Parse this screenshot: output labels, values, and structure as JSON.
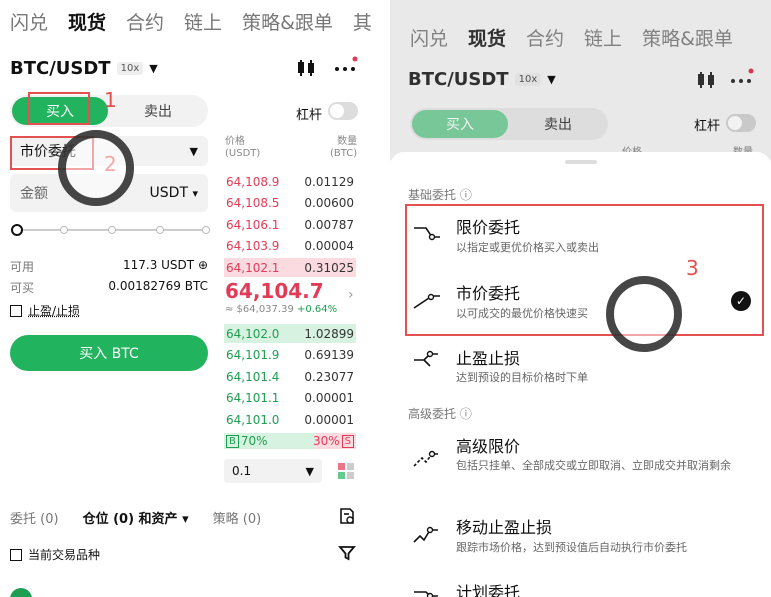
{
  "left": {
    "nav": [
      "闪兑",
      "现货",
      "合约",
      "链上",
      "策略&跟单",
      "其"
    ],
    "pair": "BTC/USDT",
    "leverage": "10x",
    "buy_tab": "买入",
    "sell_tab": "卖出",
    "margin_label": "杠杆",
    "order_type": "市价委托",
    "amount_label": "金额",
    "amount_unit": "USDT",
    "available_label": "可用",
    "available_value": "117.3 USDT",
    "can_buy_label": "可买",
    "can_buy_value": "0.00182769 BTC",
    "tpsl_label": "止盈/止损",
    "buy_button": "买入 BTC",
    "ob_price_header": "价格\n(USDT)",
    "ob_qty_header": "数量\n(BTC)",
    "asks": [
      {
        "price": "64,108.9",
        "size": "0.01129"
      },
      {
        "price": "64,108.5",
        "size": "0.00600"
      },
      {
        "price": "64,106.1",
        "size": "0.00787"
      },
      {
        "price": "64,103.9",
        "size": "0.00004"
      },
      {
        "price": "64,102.1",
        "size": "0.31025"
      }
    ],
    "last_price": "64,104.7",
    "last_usd": "≈ $64,037.39",
    "last_change": "+0.64%",
    "bids": [
      {
        "price": "64,102.0",
        "size": "1.02899"
      },
      {
        "price": "64,101.9",
        "size": "0.69139"
      },
      {
        "price": "64,101.4",
        "size": "0.23077"
      },
      {
        "price": "64,101.1",
        "size": "0.00001"
      },
      {
        "price": "64,101.0",
        "size": "0.00001"
      }
    ],
    "buy_ratio_tag": "B",
    "buy_ratio": "70%",
    "sell_ratio": "30%",
    "sell_ratio_tag": "S",
    "buy_ratio_value": 0.7,
    "precision": "0.1",
    "bottom_tabs": [
      "委托 (0)",
      "仓位 (0) 和资产 ▾",
      "策略 (0)"
    ],
    "current_pair_only": "当前交易品种",
    "annotation_1": "1",
    "annotation_2": "2"
  },
  "right": {
    "nav": [
      "闪兑",
      "现货",
      "合约",
      "链上",
      "策略&跟单"
    ],
    "pair": "BTC/USDT",
    "leverage": "10x",
    "buy_tab": "买入",
    "sell_tab": "卖出",
    "margin_label": "杠杆",
    "ob_price_header": "价格",
    "ob_qty_header": "数量",
    "section_basic": "基础委托 ⓘ",
    "section_advanced": "高级委托 ⓘ",
    "items": [
      {
        "title": "限价委托",
        "desc": "以指定或更优价格买入或卖出"
      },
      {
        "title": "市价委托",
        "desc": "以可成交的最优价格快速买"
      },
      {
        "title": "止盈止损",
        "desc": "达到预设的目标价格时下单"
      },
      {
        "title": "高级限价",
        "desc": "包括只挂单、全部成交或立即取消、立即成交并取消剩余"
      },
      {
        "title": "移动止盈止损",
        "desc": "跟踪市场价格，达到预设值后自动执行市价委托"
      },
      {
        "title": "计划委托",
        "desc": ""
      }
    ],
    "annotation_3": "3"
  },
  "colors": {
    "buy": "#22b35e",
    "sell": "#e23b57",
    "annotation": "#e35151"
  }
}
